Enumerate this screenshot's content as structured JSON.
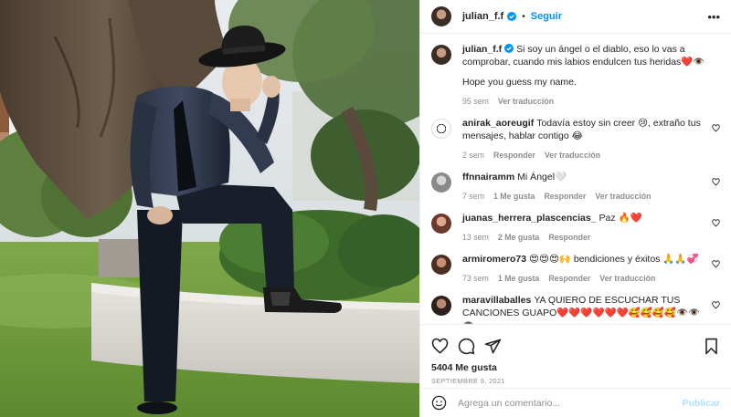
{
  "post": {
    "image_alt": "Hombre con sombrero vaquero y traje negro posando junto a un árbol en un jardín"
  },
  "header": {
    "username": "julian_f.f",
    "verified": true,
    "separator": "•",
    "follow_label": "Seguir",
    "more_icon": "more-horizontal-icon"
  },
  "caption": {
    "username": "julian_f.f",
    "text": "Si soy un ángel o el diablo, eso lo vas a comprobar, cuando mis labios endulcen tus heridas❤️👁️",
    "text2": "Hope you guess my name.",
    "time": "95 sem",
    "translate": "Ver traducción"
  },
  "comments": [
    {
      "username": "anirak_aoreugif",
      "text": "Todavía estoy sin creer 😢, extraño tus mensajes, hablar contigo 😂",
      "time": "2 sem",
      "likes": "",
      "reply": "Responder",
      "translate": "Ver traducción"
    },
    {
      "username": "ffnnairamm",
      "text": "Mi Ángel🤍",
      "time": "7 sem",
      "likes": "1 Me gusta",
      "reply": "Responder",
      "translate": "Ver traducción"
    },
    {
      "username": "juanas_herrera_plascencias_",
      "text": "Paz 🔥❤️",
      "time": "13 sem",
      "likes": "2 Me gusta",
      "reply": "Responder",
      "translate": ""
    },
    {
      "username": "armiromero73",
      "text": "😍😍😍🙌 bendiciones y éxitos 🙏🙏💞",
      "time": "73 sem",
      "likes": "1 Me gusta",
      "reply": "Responder",
      "translate": "Ver traducción"
    },
    {
      "username": "maravillaballes",
      "text": "YA QUIERO DE ESCUCHAR TUS CANCIONES GUAPO❤️❤️❤️❤️❤️❤️🥰🥰🥰🥰👁️👁️👁️",
      "time": "",
      "likes": "",
      "reply": "",
      "translate": ""
    }
  ],
  "actions": {
    "like_icon": "heart-icon",
    "comment_icon": "comment-icon",
    "share_icon": "share-icon",
    "save_icon": "bookmark-icon",
    "likes": "5404 Me gusta",
    "date": "SEPTIEMBRE 9, 2021"
  },
  "add_comment": {
    "placeholder": "Agrega un comentario...",
    "publish_label": "Publicar"
  },
  "colors": {
    "accent": "#0095f6",
    "publish_disabled": "#b2dffc",
    "muted": "#8e8e8e",
    "text": "#262626"
  }
}
